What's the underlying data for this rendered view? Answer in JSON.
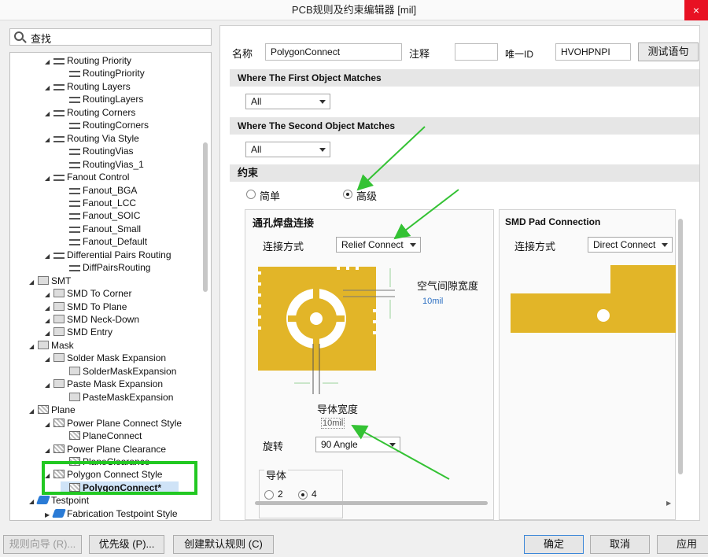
{
  "window": {
    "title": "PCB规则及约束编辑器 [mil]",
    "close_glyph": "×"
  },
  "search": {
    "label": "查找"
  },
  "tree": [
    {
      "label": "Routing Priority",
      "depth": 2,
      "icon": "route",
      "expanded": true
    },
    {
      "label": "RoutingPriority",
      "depth": 3,
      "icon": "route"
    },
    {
      "label": "Routing Layers",
      "depth": 2,
      "icon": "route",
      "expanded": true
    },
    {
      "label": "RoutingLayers",
      "depth": 3,
      "icon": "route"
    },
    {
      "label": "Routing Corners",
      "depth": 2,
      "icon": "route",
      "expanded": true
    },
    {
      "label": "RoutingCorners",
      "depth": 3,
      "icon": "route"
    },
    {
      "label": "Routing Via Style",
      "depth": 2,
      "icon": "route",
      "expanded": true
    },
    {
      "label": "RoutingVias",
      "depth": 3,
      "icon": "route"
    },
    {
      "label": "RoutingVias_1",
      "depth": 3,
      "icon": "route"
    },
    {
      "label": "Fanout Control",
      "depth": 2,
      "icon": "route",
      "expanded": true
    },
    {
      "label": "Fanout_BGA",
      "depth": 3,
      "icon": "route"
    },
    {
      "label": "Fanout_LCC",
      "depth": 3,
      "icon": "route"
    },
    {
      "label": "Fanout_SOIC",
      "depth": 3,
      "icon": "route"
    },
    {
      "label": "Fanout_Small",
      "depth": 3,
      "icon": "route"
    },
    {
      "label": "Fanout_Default",
      "depth": 3,
      "icon": "route"
    },
    {
      "label": "Differential Pairs Routing",
      "depth": 2,
      "icon": "route",
      "expanded": true
    },
    {
      "label": "DiffPairsRouting",
      "depth": 3,
      "icon": "route"
    },
    {
      "label": "SMT",
      "depth": 1,
      "icon": "smt",
      "expanded": true
    },
    {
      "label": "SMD To Corner",
      "depth": 2,
      "icon": "smt"
    },
    {
      "label": "SMD To Plane",
      "depth": 2,
      "icon": "smt"
    },
    {
      "label": "SMD Neck-Down",
      "depth": 2,
      "icon": "smt"
    },
    {
      "label": "SMD Entry",
      "depth": 2,
      "icon": "smt"
    },
    {
      "label": "Mask",
      "depth": 1,
      "icon": "box",
      "expanded": true
    },
    {
      "label": "Solder Mask Expansion",
      "depth": 2,
      "icon": "box",
      "expanded": true
    },
    {
      "label": "SolderMaskExpansion",
      "depth": 3,
      "icon": "box"
    },
    {
      "label": "Paste Mask Expansion",
      "depth": 2,
      "icon": "box",
      "expanded": true
    },
    {
      "label": "PasteMaskExpansion",
      "depth": 3,
      "icon": "box"
    },
    {
      "label": "Plane",
      "depth": 1,
      "icon": "sq",
      "expanded": true
    },
    {
      "label": "Power Plane Connect Style",
      "depth": 2,
      "icon": "sq",
      "expanded": true
    },
    {
      "label": "PlaneConnect",
      "depth": 3,
      "icon": "sq"
    },
    {
      "label": "Power Plane Clearance",
      "depth": 2,
      "icon": "sq",
      "expanded": true
    },
    {
      "label": "PlaneClearance",
      "depth": 3,
      "icon": "sq"
    },
    {
      "label": "Polygon Connect Style",
      "depth": 2,
      "icon": "sq",
      "expanded": true
    },
    {
      "label": "PolygonConnect*",
      "depth": 3,
      "icon": "sq",
      "selected": true
    },
    {
      "label": "Testpoint",
      "depth": 1,
      "icon": "tp",
      "expanded": true
    },
    {
      "label": "Fabrication Testpoint Style",
      "depth": 2,
      "icon": "tp",
      "collapsed": true
    }
  ],
  "header": {
    "name_label": "名称",
    "name_value": "PolygonConnect",
    "comment_label": "注释",
    "comment_value": "",
    "uid_label": "唯一ID",
    "uid_value": "HVOHPNPI",
    "test_button": "测试语句"
  },
  "first_match": {
    "title": "Where The First Object Matches",
    "value": "All"
  },
  "second_match": {
    "title": "Where The Second Object Matches",
    "value": "All"
  },
  "constraints": {
    "title": "约束",
    "mode_simple": "简单",
    "mode_advanced": "高级",
    "selected_mode": "advanced"
  },
  "via_panel": {
    "title": "通孔焊盘连接",
    "connect_label": "连接方式",
    "connect_value": "Relief Connect",
    "air_gap_label": "空气间隙宽度",
    "air_gap_value": "10mil",
    "conductor_width_label": "导体宽度",
    "conductor_width_value": "10mil",
    "rotation_label": "旋转",
    "rotation_value": "90 Angle",
    "conductors_label": "导体",
    "conductors_opt1": "2",
    "conductors_opt2": "4",
    "conductors_selected": "4"
  },
  "smd_panel": {
    "title": "SMD Pad Connection",
    "connect_label": "连接方式",
    "connect_value": "Direct Connect"
  },
  "footer": {
    "wizard": "规则向导 (R)...",
    "priority": "优先级 (P)...",
    "create_default": "创建默认规则 (C)",
    "ok": "确定",
    "cancel": "取消",
    "apply": "应用"
  },
  "colors": {
    "copper": "#e2b528",
    "annotation_arrow": "#34c234",
    "highlight_box": "#22c822",
    "selection": "#cfe3f7"
  }
}
